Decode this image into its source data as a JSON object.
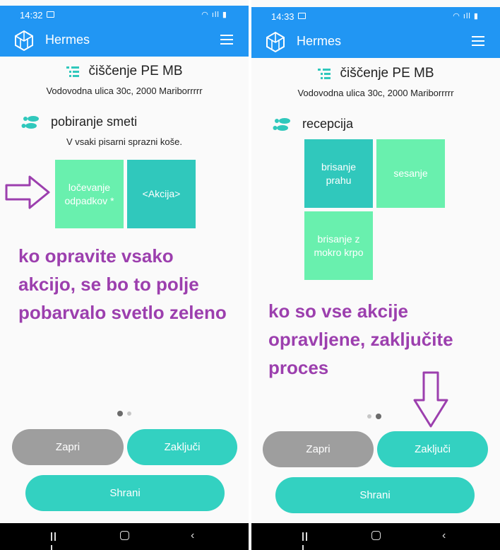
{
  "colors": {
    "appbar": "#2196f3",
    "tile_light": "#69f0ae",
    "tile_dark": "#30c8bc",
    "button_teal": "#33d1c1",
    "button_grey": "#9e9e9e",
    "annotation": "#9c3fae"
  },
  "screen1": {
    "status": {
      "time": "14:32"
    },
    "app": {
      "title": "Hermes"
    },
    "task": {
      "title": "čiščenje PE MB",
      "address": "Vodovodna ulica 30c, 2000 Mariborrrrr"
    },
    "section": {
      "title": "pobiranje smeti",
      "description": "V vsaki pisarni sprazni koše."
    },
    "tiles": [
      {
        "label": "ločevanje odpadkov *",
        "done": true
      },
      {
        "label": "<Akcija>",
        "done": false
      }
    ],
    "annotation": "ko opravite vsako akcijo, se bo to polje pobarvalo svetlo zeleno",
    "buttons": {
      "close": "Zapri",
      "finish": "Zaključi",
      "save": "Shrani"
    }
  },
  "screen2": {
    "status": {
      "time": "14:33"
    },
    "app": {
      "title": "Hermes"
    },
    "task": {
      "title": "čiščenje PE MB",
      "address": "Vodovodna ulica 30c, 2000 Mariborrrrr"
    },
    "section": {
      "title": "recepcija"
    },
    "tiles": [
      {
        "label": "brisanje prahu",
        "done": false
      },
      {
        "label": "sesanje",
        "done": true
      },
      {
        "label": "brisanje z mokro krpo",
        "done": true
      }
    ],
    "annotation": "ko so vse akcije opravljene, zaključite proces",
    "buttons": {
      "close": "Zapri",
      "finish": "Zaključi",
      "save": "Shrani"
    }
  }
}
